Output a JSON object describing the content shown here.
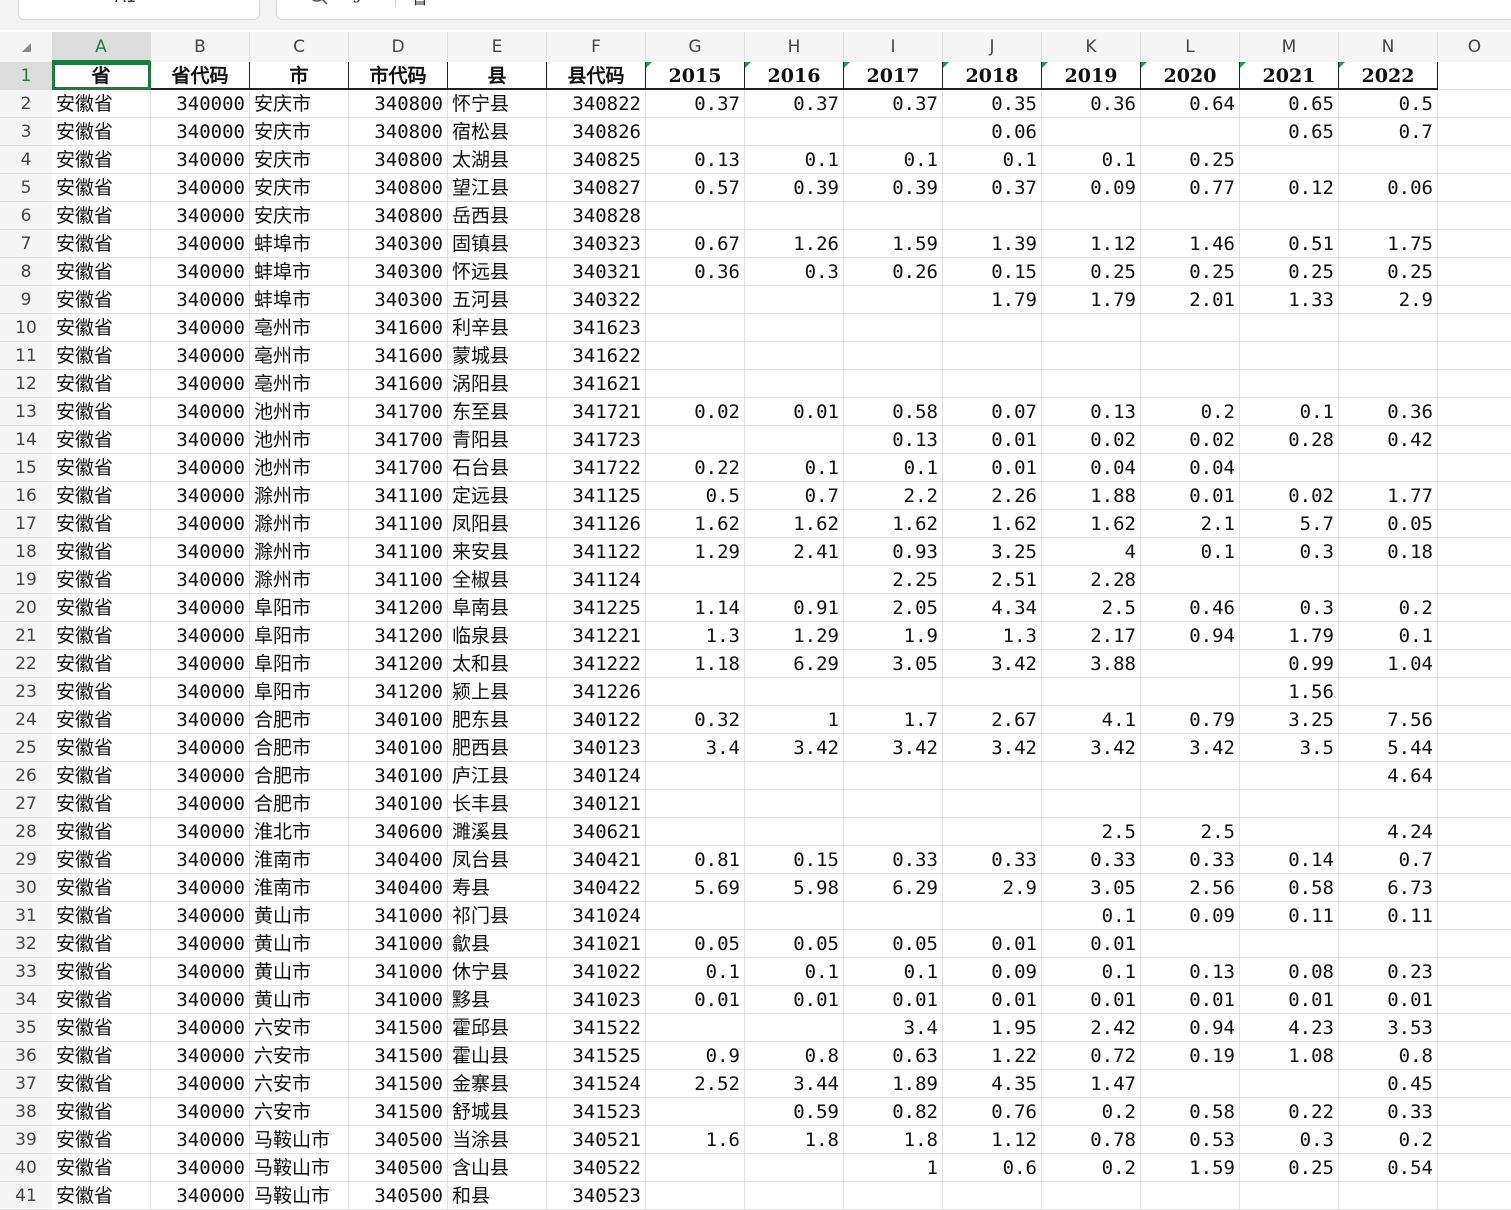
{
  "formula_bar": {
    "name_box": "A1",
    "value": "省"
  },
  "columns": [
    "A",
    "B",
    "C",
    "D",
    "E",
    "F",
    "G",
    "H",
    "I",
    "J",
    "K",
    "L",
    "M",
    "N",
    "O"
  ],
  "selected_column": "A",
  "selected_row": 1,
  "header": [
    "省",
    "省代码",
    "市",
    "市代码",
    "县",
    "县代码",
    "2015",
    "2016",
    "2017",
    "2018",
    "2019",
    "2020",
    "2021",
    "2022"
  ],
  "rows": [
    [
      "安徽省",
      "340000",
      "安庆市",
      "340800",
      "怀宁县",
      "340822",
      "0.37",
      "0.37",
      "0.37",
      "0.35",
      "0.36",
      "0.64",
      "0.65",
      "0.5"
    ],
    [
      "安徽省",
      "340000",
      "安庆市",
      "340800",
      "宿松县",
      "340826",
      "",
      "",
      "",
      "0.06",
      "",
      "",
      "0.65",
      "0.7"
    ],
    [
      "安徽省",
      "340000",
      "安庆市",
      "340800",
      "太湖县",
      "340825",
      "0.13",
      "0.1",
      "0.1",
      "0.1",
      "0.1",
      "0.25",
      "",
      ""
    ],
    [
      "安徽省",
      "340000",
      "安庆市",
      "340800",
      "望江县",
      "340827",
      "0.57",
      "0.39",
      "0.39",
      "0.37",
      "0.09",
      "0.77",
      "0.12",
      "0.06"
    ],
    [
      "安徽省",
      "340000",
      "安庆市",
      "340800",
      "岳西县",
      "340828",
      "",
      "",
      "",
      "",
      "",
      "",
      "",
      ""
    ],
    [
      "安徽省",
      "340000",
      "蚌埠市",
      "340300",
      "固镇县",
      "340323",
      "0.67",
      "1.26",
      "1.59",
      "1.39",
      "1.12",
      "1.46",
      "0.51",
      "1.75"
    ],
    [
      "安徽省",
      "340000",
      "蚌埠市",
      "340300",
      "怀远县",
      "340321",
      "0.36",
      "0.3",
      "0.26",
      "0.15",
      "0.25",
      "0.25",
      "0.25",
      "0.25"
    ],
    [
      "安徽省",
      "340000",
      "蚌埠市",
      "340300",
      "五河县",
      "340322",
      "",
      "",
      "",
      "1.79",
      "1.79",
      "2.01",
      "1.33",
      "2.9"
    ],
    [
      "安徽省",
      "340000",
      "亳州市",
      "341600",
      "利辛县",
      "341623",
      "",
      "",
      "",
      "",
      "",
      "",
      "",
      ""
    ],
    [
      "安徽省",
      "340000",
      "亳州市",
      "341600",
      "蒙城县",
      "341622",
      "",
      "",
      "",
      "",
      "",
      "",
      "",
      ""
    ],
    [
      "安徽省",
      "340000",
      "亳州市",
      "341600",
      "涡阳县",
      "341621",
      "",
      "",
      "",
      "",
      "",
      "",
      "",
      ""
    ],
    [
      "安徽省",
      "340000",
      "池州市",
      "341700",
      "东至县",
      "341721",
      "0.02",
      "0.01",
      "0.58",
      "0.07",
      "0.13",
      "0.2",
      "0.1",
      "0.36"
    ],
    [
      "安徽省",
      "340000",
      "池州市",
      "341700",
      "青阳县",
      "341723",
      "",
      "",
      "0.13",
      "0.01",
      "0.02",
      "0.02",
      "0.28",
      "0.42"
    ],
    [
      "安徽省",
      "340000",
      "池州市",
      "341700",
      "石台县",
      "341722",
      "0.22",
      "0.1",
      "0.1",
      "0.01",
      "0.04",
      "0.04",
      "",
      ""
    ],
    [
      "安徽省",
      "340000",
      "滁州市",
      "341100",
      "定远县",
      "341125",
      "0.5",
      "0.7",
      "2.2",
      "2.26",
      "1.88",
      "0.01",
      "0.02",
      "1.77"
    ],
    [
      "安徽省",
      "340000",
      "滁州市",
      "341100",
      "凤阳县",
      "341126",
      "1.62",
      "1.62",
      "1.62",
      "1.62",
      "1.62",
      "2.1",
      "5.7",
      "0.05"
    ],
    [
      "安徽省",
      "340000",
      "滁州市",
      "341100",
      "来安县",
      "341122",
      "1.29",
      "2.41",
      "0.93",
      "3.25",
      "4",
      "0.1",
      "0.3",
      "0.18"
    ],
    [
      "安徽省",
      "340000",
      "滁州市",
      "341100",
      "全椒县",
      "341124",
      "",
      "",
      "2.25",
      "2.51",
      "2.28",
      "",
      "",
      ""
    ],
    [
      "安徽省",
      "340000",
      "阜阳市",
      "341200",
      "阜南县",
      "341225",
      "1.14",
      "0.91",
      "2.05",
      "4.34",
      "2.5",
      "0.46",
      "0.3",
      "0.2"
    ],
    [
      "安徽省",
      "340000",
      "阜阳市",
      "341200",
      "临泉县",
      "341221",
      "1.3",
      "1.29",
      "1.9",
      "1.3",
      "2.17",
      "0.94",
      "1.79",
      "0.1"
    ],
    [
      "安徽省",
      "340000",
      "阜阳市",
      "341200",
      "太和县",
      "341222",
      "1.18",
      "6.29",
      "3.05",
      "3.42",
      "3.88",
      "",
      "0.99",
      "1.04"
    ],
    [
      "安徽省",
      "340000",
      "阜阳市",
      "341200",
      "颍上县",
      "341226",
      "",
      "",
      "",
      "",
      "",
      "",
      "1.56",
      ""
    ],
    [
      "安徽省",
      "340000",
      "合肥市",
      "340100",
      "肥东县",
      "340122",
      "0.32",
      "1",
      "1.7",
      "2.67",
      "4.1",
      "0.79",
      "3.25",
      "7.56"
    ],
    [
      "安徽省",
      "340000",
      "合肥市",
      "340100",
      "肥西县",
      "340123",
      "3.4",
      "3.42",
      "3.42",
      "3.42",
      "3.42",
      "3.42",
      "3.5",
      "5.44"
    ],
    [
      "安徽省",
      "340000",
      "合肥市",
      "340100",
      "庐江县",
      "340124",
      "",
      "",
      "",
      "",
      "",
      "",
      "",
      "4.64"
    ],
    [
      "安徽省",
      "340000",
      "合肥市",
      "340100",
      "长丰县",
      "340121",
      "",
      "",
      "",
      "",
      "",
      "",
      "",
      ""
    ],
    [
      "安徽省",
      "340000",
      "淮北市",
      "340600",
      "濉溪县",
      "340621",
      "",
      "",
      "",
      "",
      "2.5",
      "2.5",
      "",
      "4.24"
    ],
    [
      "安徽省",
      "340000",
      "淮南市",
      "340400",
      "凤台县",
      "340421",
      "0.81",
      "0.15",
      "0.33",
      "0.33",
      "0.33",
      "0.33",
      "0.14",
      "0.7"
    ],
    [
      "安徽省",
      "340000",
      "淮南市",
      "340400",
      "寿县",
      "340422",
      "5.69",
      "5.98",
      "6.29",
      "2.9",
      "3.05",
      "2.56",
      "0.58",
      "6.73"
    ],
    [
      "安徽省",
      "340000",
      "黄山市",
      "341000",
      "祁门县",
      "341024",
      "",
      "",
      "",
      "",
      "0.1",
      "0.09",
      "0.11",
      "0.11"
    ],
    [
      "安徽省",
      "340000",
      "黄山市",
      "341000",
      "歙县",
      "341021",
      "0.05",
      "0.05",
      "0.05",
      "0.01",
      "0.01",
      "",
      "",
      ""
    ],
    [
      "安徽省",
      "340000",
      "黄山市",
      "341000",
      "休宁县",
      "341022",
      "0.1",
      "0.1",
      "0.1",
      "0.09",
      "0.1",
      "0.13",
      "0.08",
      "0.23"
    ],
    [
      "安徽省",
      "340000",
      "黄山市",
      "341000",
      "黟县",
      "341023",
      "0.01",
      "0.01",
      "0.01",
      "0.01",
      "0.01",
      "0.01",
      "0.01",
      "0.01"
    ],
    [
      "安徽省",
      "340000",
      "六安市",
      "341500",
      "霍邱县",
      "341522",
      "",
      "",
      "3.4",
      "1.95",
      "2.42",
      "0.94",
      "4.23",
      "3.53"
    ],
    [
      "安徽省",
      "340000",
      "六安市",
      "341500",
      "霍山县",
      "341525",
      "0.9",
      "0.8",
      "0.63",
      "1.22",
      "0.72",
      "0.19",
      "1.08",
      "0.8"
    ],
    [
      "安徽省",
      "340000",
      "六安市",
      "341500",
      "金寨县",
      "341524",
      "2.52",
      "3.44",
      "1.89",
      "4.35",
      "1.47",
      "",
      "",
      "0.45"
    ],
    [
      "安徽省",
      "340000",
      "六安市",
      "341500",
      "舒城县",
      "341523",
      "",
      "0.59",
      "0.82",
      "0.76",
      "0.2",
      "0.58",
      "0.22",
      "0.33"
    ],
    [
      "安徽省",
      "340000",
      "马鞍山市",
      "340500",
      "当涂县",
      "340521",
      "1.6",
      "1.8",
      "1.8",
      "1.12",
      "0.78",
      "0.53",
      "0.3",
      "0.2"
    ],
    [
      "安徽省",
      "340000",
      "马鞍山市",
      "340500",
      "含山县",
      "340522",
      "",
      "",
      "1",
      "0.6",
      "0.2",
      "1.59",
      "0.25",
      "0.54"
    ],
    [
      "安徽省",
      "340000",
      "马鞍山市",
      "340500",
      "和县",
      "340523",
      "",
      "",
      "",
      "",
      "",
      "",
      "",
      ""
    ]
  ]
}
